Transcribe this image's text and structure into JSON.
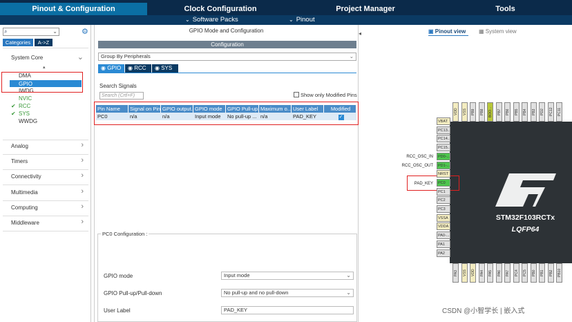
{
  "tabs": {
    "pinout": "Pinout & Configuration",
    "clock": "Clock Configuration",
    "project": "Project Manager",
    "tools": "Tools"
  },
  "subbar": {
    "software_packs": "Software Packs",
    "pinout": "Pinout"
  },
  "sidebar": {
    "search_placeholder": "",
    "tab_categories": "Categories",
    "tab_az": "A->Z",
    "system_core": "System Core",
    "items": [
      "DMA",
      "GPIO",
      "IWDG",
      "NVIC",
      "RCC",
      "SYS",
      "WWDG"
    ],
    "checked": [
      false,
      false,
      false,
      false,
      true,
      true,
      false
    ],
    "categories": [
      "Analog",
      "Timers",
      "Connectivity",
      "Multimedia",
      "Computing",
      "Middleware"
    ]
  },
  "middle": {
    "title": "GPIO Mode and Configuration",
    "config_header": "Configuration",
    "group_by": "Group By Peripherals",
    "sub_tabs": [
      "GPIO",
      "RCC",
      "SYS"
    ],
    "search_label": "Search Signals",
    "search_placeholder": "Search (Crtl+F)",
    "show_modified": "Show only Modified Pins",
    "columns": [
      "Pin Name",
      "Signal on Pin",
      "GPIO output...",
      "GPIO mode",
      "GPIO Pull-up...",
      "Maximum o...",
      "User Label",
      "Modified"
    ],
    "row": [
      "PC0",
      "n/a",
      "n/a",
      "Input mode",
      "No pull-up ...",
      "n/a",
      "PAD_KEY",
      ""
    ],
    "pc0_config": "PC0 Configuration :",
    "gpio_mode_label": "GPIO mode",
    "gpio_mode_value": "Input mode",
    "pull_label": "GPIO Pull-up/Pull-down",
    "pull_value": "No pull-up and no pull-down",
    "user_label_label": "User Label",
    "user_label_value": "PAD_KEY"
  },
  "right": {
    "pinout_view": "Pinout view",
    "system_view": "System view",
    "chip_name": "STM32F103RCTx",
    "package": "LQFP64",
    "top_pins": [
      "VDD",
      "VSS",
      "PB9",
      "PB8",
      "BOO...",
      "PB7",
      "PB6",
      "PB5",
      "PB4",
      "PB3",
      "PD2",
      "PC12",
      "PC11"
    ],
    "left_pins": [
      "VBAT",
      "PC13...",
      "PC14...",
      "PC15...",
      "PD0-...",
      "PD1-...",
      "NRST",
      "PC0",
      "PC1",
      "PC2",
      "PC3",
      "VSSA",
      "VDDA",
      "PA0-...",
      "PA1",
      "PA2"
    ],
    "bottom_pins": [
      "PA3",
      "VSS",
      "VDD",
      "PA4",
      "PA5",
      "PA6",
      "PA7",
      "PC4",
      "PC5",
      "PB0",
      "PB1",
      "PB2",
      "PB10"
    ],
    "signals": {
      "osc_in": "RCC_OSC_IN",
      "osc_out": "RCC_OSC_OUT",
      "pad_key": "PAD_KEY"
    },
    "watermark": "CSDN @小智学长 | 嵌入式"
  }
}
